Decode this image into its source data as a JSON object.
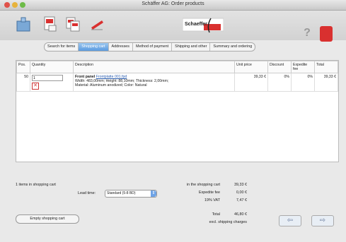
{
  "window": {
    "title": "Schäffer AG: Order products"
  },
  "tabs": [
    "Search for items",
    "Shopping cart",
    "Addresses",
    "Method of payment",
    "Shipping and other",
    "Summary and ordering"
  ],
  "active_tab": "Shopping cart",
  "table": {
    "headers": [
      "Pos.",
      "Quantity",
      "Description",
      "Unit price",
      "Discount",
      "Expedite fee",
      "Total"
    ],
    "rows": [
      {
        "pos": "50",
        "qty": "1",
        "desc_title": "Front panel",
        "desc_link": "Frontplatte 001.fpd",
        "desc_line2": "Width: 483,00mm; Height: 88,10mm; Thickness: 2,00mm;",
        "desc_line3": "Material: Aluminum anodized; Color: Natural",
        "unit_price": "39,33 €",
        "discount": "0%",
        "expedite": "0%",
        "total": "39,33 €"
      }
    ]
  },
  "summary": {
    "items_in_cart": "1 items in shopping cart",
    "lead_time_label": "Lead time:",
    "lead_time_value": "Standard (5-8 BD)",
    "in_cart_label": "in the shopping cart",
    "in_cart_value": "39,33 €",
    "expedite_label": "Expedite fee",
    "expedite_value": "0,00 €",
    "vat_label": "19% VAT",
    "vat_value": "7,47 €",
    "total_label": "Total",
    "total_value": "46,80 €",
    "shipping_note": "excl. shipping charges",
    "empty_button": "Empty shopping cart"
  },
  "colors": {
    "accent": "#5b9be0",
    "delete": "#cc3333"
  }
}
